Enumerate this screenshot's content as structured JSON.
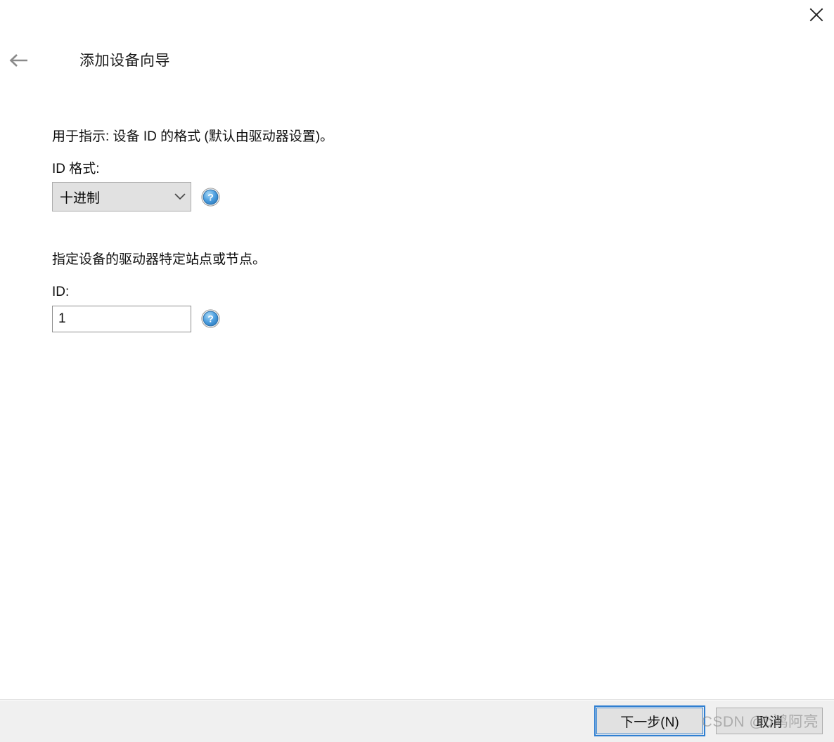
{
  "window": {
    "close_label": "×",
    "back_label": "←"
  },
  "header": {
    "title": "添加设备向导"
  },
  "main": {
    "sections": [
      {
        "instruction": "用于指示: 设备 ID 的格式 (默认由驱动器设置)。",
        "label": "ID 格式:",
        "control": "combobox",
        "value": "十进制",
        "help": "?"
      },
      {
        "instruction": "指定设备的驱动器特定站点或节点。",
        "label": "ID:",
        "control": "textinput",
        "value": "1",
        "placeholder": "",
        "help": "?"
      }
    ]
  },
  "footer": {
    "next_label": "下一步(N)",
    "cancel_label": "取消"
  },
  "watermark": {
    "text": "CSDN @b鸿阿亮"
  },
  "colors": {
    "focus_blue": "#2f7fd1",
    "help_blue": "#3f9ade",
    "footer_bg": "#f0f0f0",
    "control_bg": "#e1e1e1",
    "border": "#adadad"
  }
}
